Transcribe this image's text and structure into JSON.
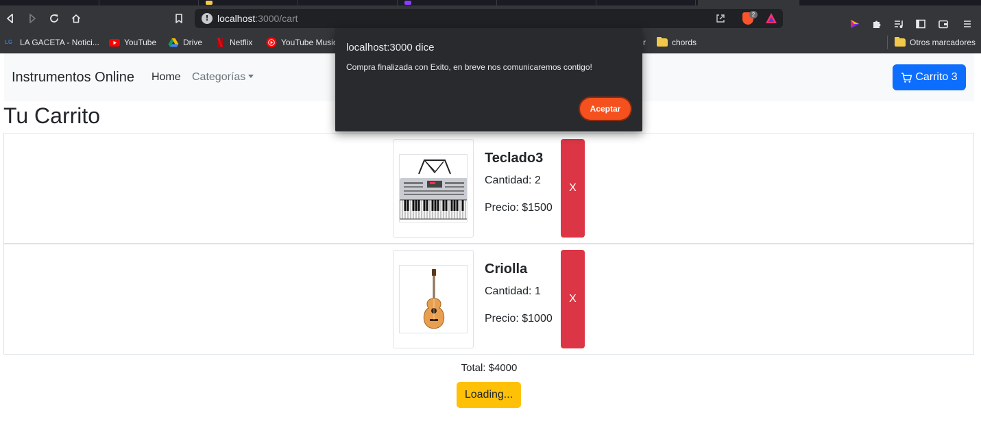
{
  "browser": {
    "url_host": "localhost",
    "url_path": ":3000/cart",
    "shields_count": "2",
    "bookmarks": [
      {
        "label": "LA GACETA - Notici..."
      },
      {
        "label": "YouTube"
      },
      {
        "label": "Drive"
      },
      {
        "label": "Netflix"
      },
      {
        "label": "YouTube Music"
      },
      {
        "label": "r"
      },
      {
        "label": "chords"
      },
      {
        "label": "Otros marcadores"
      }
    ],
    "lg_icon_text": "LG"
  },
  "navbar": {
    "brand": "Instrumentos Online",
    "home": "Home",
    "categories": "Categorías",
    "cart_label": "Carrito 3"
  },
  "page": {
    "title": "Tu Carrito",
    "items": [
      {
        "name": "Teclado3",
        "quantity": "Cantidad: 2",
        "price": "Precio: $1500",
        "delete_label": "X",
        "image": "keyboard"
      },
      {
        "name": "Criolla",
        "quantity": "Cantidad: 1",
        "price": "Precio: $1000",
        "delete_label": "X",
        "image": "guitar"
      }
    ],
    "total": "Total: $4000",
    "checkout_label": "Loading..."
  },
  "dialog": {
    "title": "localhost:3000 dice",
    "message": "Compra finalizada con Exito, en breve nos comunicaremos contigo!",
    "ok_label": "Aceptar"
  },
  "colors": {
    "primary": "#0d6efd",
    "danger": "#dc3545",
    "warning": "#ffc107",
    "dialog_accent": "#f4511e"
  }
}
